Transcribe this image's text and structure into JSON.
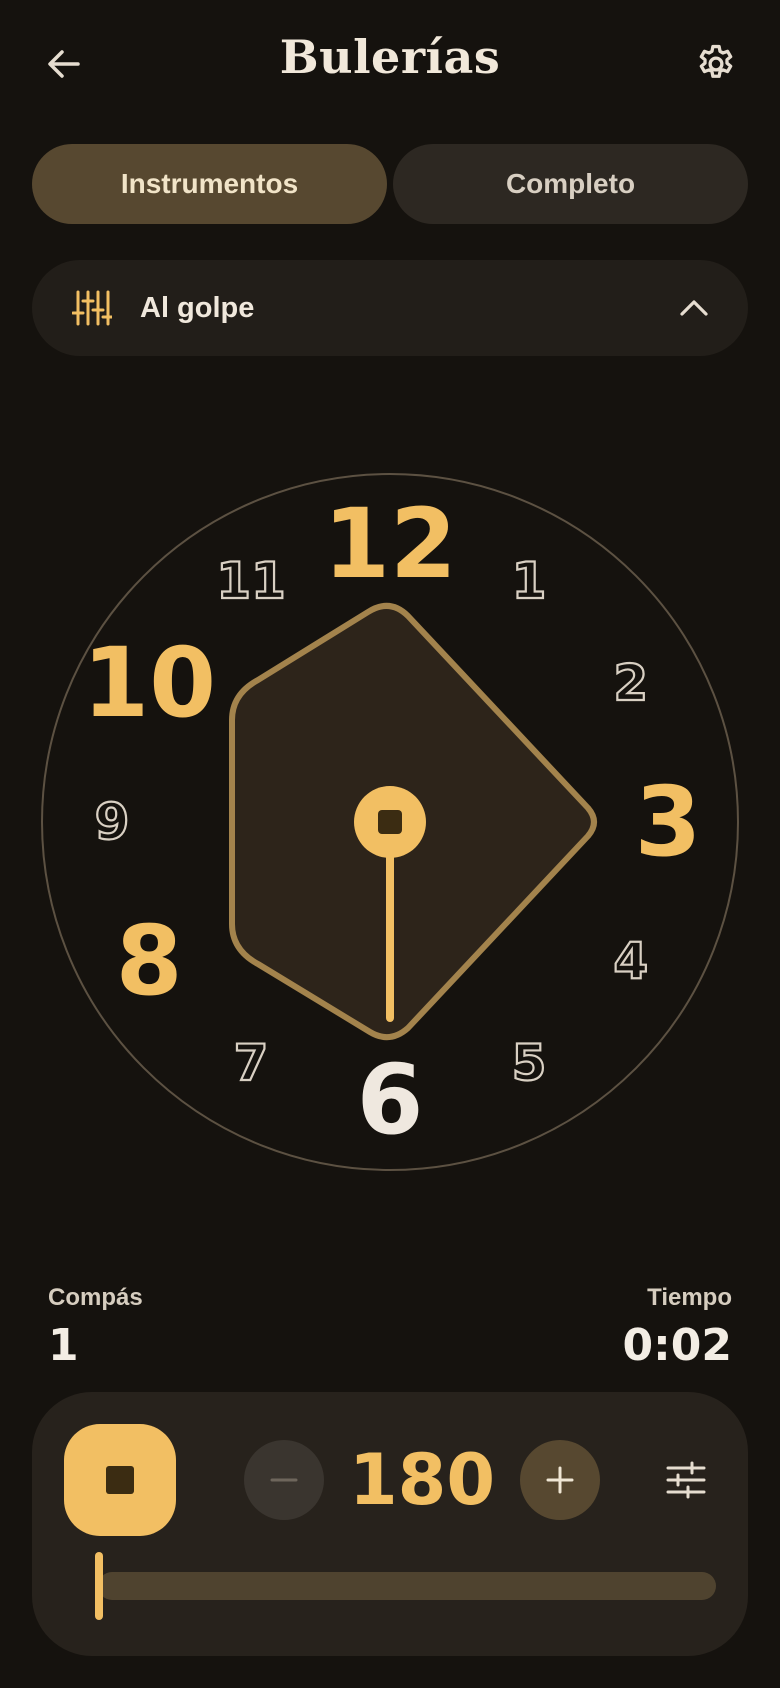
{
  "header": {
    "title": "Bulerías",
    "back_icon": "arrow-left-icon",
    "settings_icon": "gear-icon"
  },
  "tabs": [
    {
      "label": "Instrumentos",
      "active": true
    },
    {
      "label": "Completo",
      "active": false
    }
  ],
  "preset": {
    "icon": "sliders-icon",
    "label": "Al golpe",
    "chevron": "chevron-up-icon"
  },
  "clock": {
    "numbers": [
      "12",
      "1",
      "2",
      "3",
      "4",
      "5",
      "6",
      "7",
      "8",
      "9",
      "10",
      "11"
    ],
    "accented": [
      "12",
      "3",
      "6",
      "8",
      "10"
    ],
    "current": "6",
    "accent_color": "#f2bf63",
    "current_color": "#efe8df",
    "outline_color": "#d9d0c3"
  },
  "stats": {
    "compas_label": "Compás",
    "compas_value": "1",
    "tiempo_label": "Tiempo",
    "tiempo_value": "0:02"
  },
  "player": {
    "stop_icon": "stop-icon",
    "minus_icon": "minus-icon",
    "plus_icon": "plus-icon",
    "bpm": "180",
    "mixer_icon": "sliders-horizontal-icon",
    "progress": 0.0
  }
}
